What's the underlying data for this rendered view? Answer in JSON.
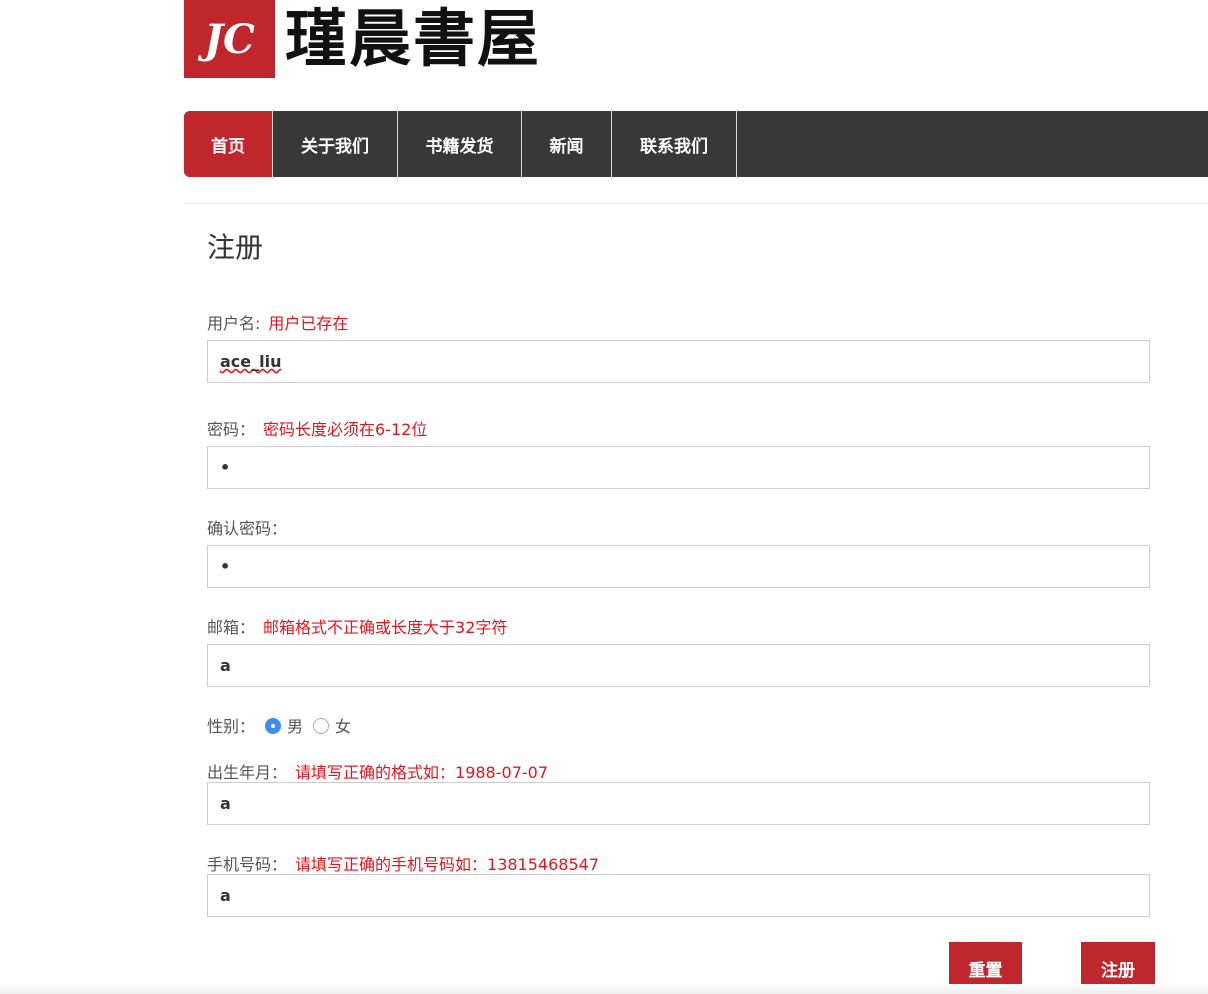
{
  "logo": {
    "abbr": "JC",
    "name": "瑾晨書屋"
  },
  "nav": {
    "items": [
      {
        "label": "首页"
      },
      {
        "label": "关于我们"
      },
      {
        "label": "书籍发货"
      },
      {
        "label": "新闻"
      },
      {
        "label": "联系我们"
      }
    ]
  },
  "page_title": "注册",
  "form": {
    "username": {
      "label": "用户名:",
      "error": "用户已存在",
      "value": "ace_liu"
    },
    "password": {
      "label": "密码：",
      "error": "密码长度必须在6-12位",
      "value": "•"
    },
    "confirm": {
      "label": "确认密码：",
      "value": "•"
    },
    "email": {
      "label": "邮箱：",
      "error": "邮箱格式不正确或长度大于32字符",
      "value": "a"
    },
    "gender": {
      "label": "性别：",
      "options": [
        "男",
        "女"
      ],
      "selected": "男"
    },
    "birth": {
      "label": "出生年月：",
      "error": "请填写正确的格式如：1988-07-07",
      "value": "a"
    },
    "phone": {
      "label": "手机号码：",
      "error": "请填写正确的手机号码如：13815468547",
      "value": "a"
    },
    "reset_label": "重置",
    "submit_label": "注册"
  },
  "colors": {
    "brand": "#c0272d",
    "nav_bg": "#383838",
    "error": "#e8141c",
    "radio": "#3b8ef0"
  }
}
